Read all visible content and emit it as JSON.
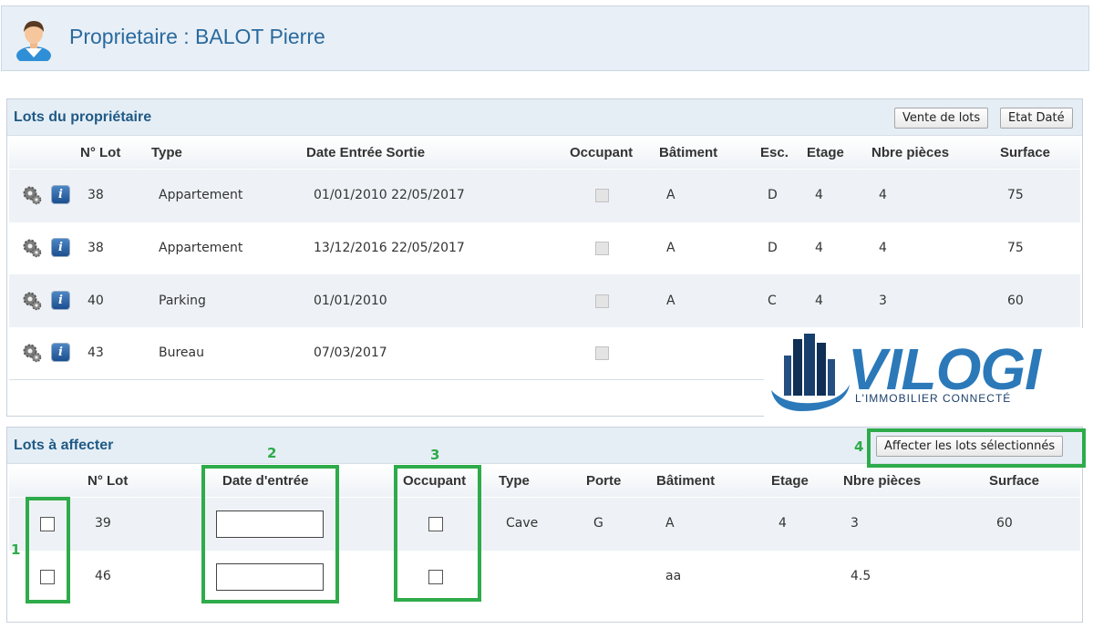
{
  "header": {
    "title": "Proprietaire : BALOT Pierre"
  },
  "lots_proprietaire": {
    "title": "Lots du propriétaire",
    "buttons": {
      "vente": "Vente de lots",
      "etat": "Etat Daté"
    },
    "columns": [
      "N° Lot",
      "Type",
      "Date Entrée Sortie",
      "Occupant",
      "Bâtiment",
      "Esc.",
      "Etage",
      "Nbre pièces",
      "Surface"
    ],
    "rows": [
      {
        "lot": "38",
        "type": "Appartement",
        "dates": "01/01/2010 22/05/2017",
        "batiment": "A",
        "esc": "D",
        "etage": "4",
        "pieces": "4",
        "surface": "75"
      },
      {
        "lot": "38",
        "type": "Appartement",
        "dates": "13/12/2016 22/05/2017",
        "batiment": "A",
        "esc": "D",
        "etage": "4",
        "pieces": "4",
        "surface": "75"
      },
      {
        "lot": "40",
        "type": "Parking",
        "dates": "01/01/2010",
        "batiment": "A",
        "esc": "C",
        "etage": "4",
        "pieces": "3",
        "surface": "60"
      },
      {
        "lot": "43",
        "type": "Bureau",
        "dates": "07/03/2017",
        "batiment": "",
        "esc": "",
        "etage": "",
        "pieces": "",
        "surface": ""
      }
    ]
  },
  "lots_affecter": {
    "title": "Lots à affecter",
    "button": "Affecter les lots sélectionnés",
    "columns": [
      "N° Lot",
      "Date d'entrée",
      "Occupant",
      "Type",
      "Porte",
      "Bâtiment",
      "Etage",
      "Nbre pièces",
      "Surface"
    ],
    "rows": [
      {
        "lot": "39",
        "date_value": "",
        "type": "Cave",
        "porte": "G",
        "batiment": "A",
        "etage": "4",
        "pieces": "3",
        "surface": "60"
      },
      {
        "lot": "46",
        "date_value": "",
        "type": "",
        "porte": "",
        "batiment": "aa",
        "etage": "",
        "pieces": "4.5",
        "surface": ""
      }
    ]
  },
  "annotations": [
    "1",
    "2",
    "3",
    "4"
  ],
  "logo": {
    "name": "VILOGI",
    "tagline": "L'IMMOBILIER CONNECTÉ"
  },
  "colors": {
    "accent": "#2a6a9e",
    "highlight": "#2eab4a",
    "header_bg": "#e8eff6"
  }
}
